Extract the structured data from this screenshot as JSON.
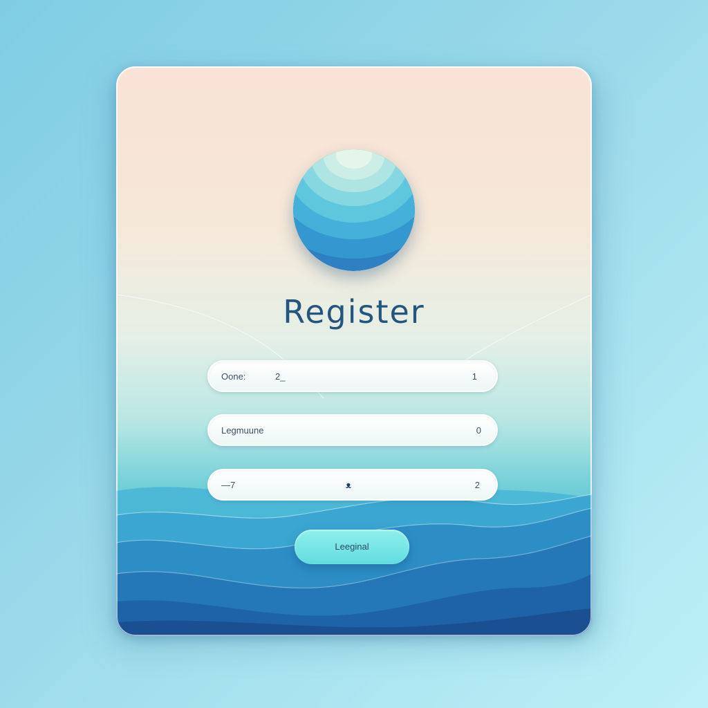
{
  "form": {
    "title": "Register",
    "fields": [
      {
        "label": "Oone:",
        "value": "2_",
        "trailing": "1"
      },
      {
        "label": "Legmuune",
        "value": "",
        "trailing": "0"
      },
      {
        "label": "—7",
        "value": "ᴥ",
        "trailing": "2"
      }
    ],
    "submit_label": "Leeginal"
  },
  "logo": {
    "icon": "globe-logo-icon"
  },
  "colors": {
    "title": "#24557f",
    "button": "#6ee3e4",
    "wave_dark": "#1f5a9e",
    "background": "#9ad9ea"
  }
}
